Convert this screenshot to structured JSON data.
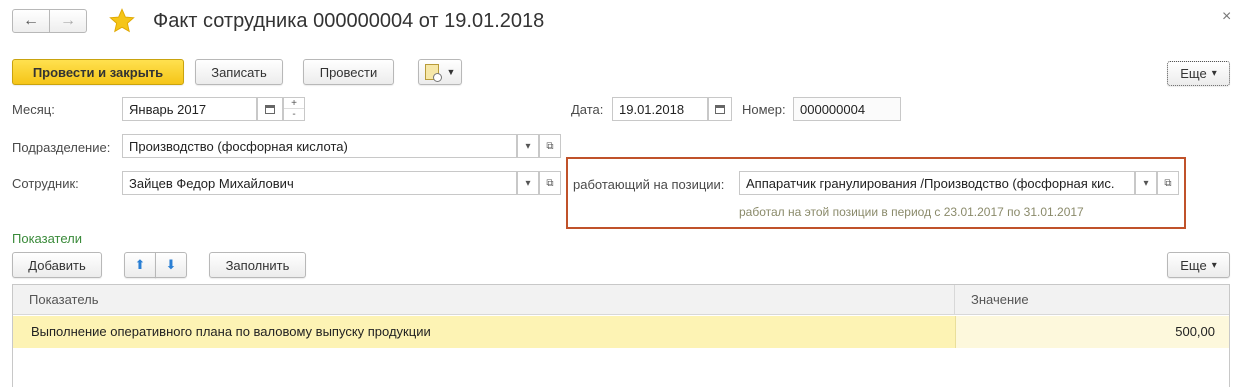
{
  "window": {
    "title": "Факт сотрудника 000000004 от 19.01.2018",
    "close_glyph": "×",
    "back_glyph": "←",
    "forward_glyph": "→",
    "star_color": "#f5c518"
  },
  "toolbar": {
    "post_and_close": "Провести и закрыть",
    "save": "Записать",
    "post": "Провести",
    "more": "Еще",
    "more_arrow": "▾"
  },
  "form": {
    "month_label": "Месяц:",
    "month_value": "Январь 2017",
    "date_label": "Дата:",
    "date_value": "19.01.2018",
    "number_label": "Номер:",
    "number_value": "000000004",
    "department_label": "Подразделение:",
    "department_value": "Производство (фосфорная кислота)",
    "employee_label": "Сотрудник:",
    "employee_value": "Зайцев Федор Михайлович",
    "position_label": "работающий на позиции:",
    "position_value": "Аппаратчик гранулирования /Производство (фосфорная кис.",
    "position_note": "работал на этой позиции в период с 23.01.2017 по 31.01.2017"
  },
  "indicators": {
    "section_title": "Показатели",
    "add": "Добавить",
    "fill": "Заполнить",
    "more": "Еще",
    "more_arrow": "▾",
    "columns": [
      "Показатель",
      "Значение"
    ],
    "rows": [
      {
        "name": "Выполнение оперативного плана по валовому выпуску продукции",
        "value": "500,00"
      }
    ]
  },
  "colors": {
    "accent_border": "#c0522a",
    "section_green": "#3a8a3a",
    "note_text": "#8a8a6a",
    "row_highlight": "#fdf3b4"
  }
}
